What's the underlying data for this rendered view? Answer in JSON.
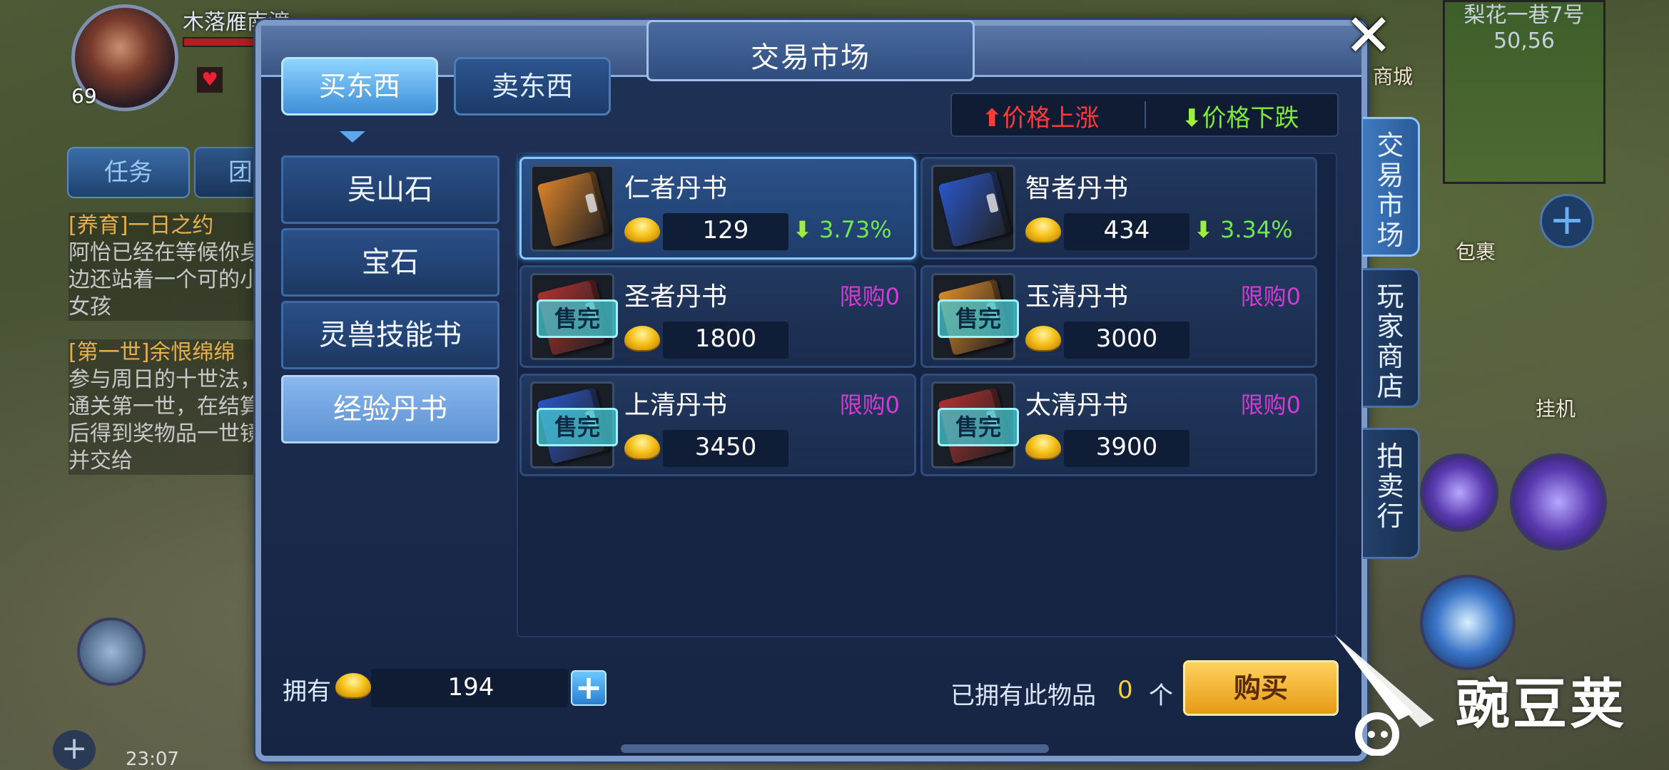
{
  "hud": {
    "player_name": "木落雁南渡",
    "level": "69",
    "task_tab": "任务",
    "team_tab": "团",
    "quests": [
      {
        "title": "[养育]一日之约",
        "desc": "阿怡已经在等候你身边还站着一个可的小女孩"
      },
      {
        "title": "[第一世]余恨绵绵",
        "desc": "参与周日的十世法，通关第一世，在结算后得到奖物品一世镜并交给"
      }
    ],
    "minimap": {
      "location": "梨花一巷7号",
      "coords": "50,56"
    },
    "shop_label": "商城",
    "bag_label": "包裹",
    "auto_label": "挂机",
    "clock": "23:07"
  },
  "dialog": {
    "title": "交易市场",
    "close_icon": "close-x",
    "tabs": [
      {
        "label": "买东西",
        "active": true
      },
      {
        "label": "卖东西",
        "active": false
      }
    ],
    "legend": {
      "up": "价格上涨",
      "down": "价格下跌",
      "up_color": "#ff3a3a",
      "down_color": "#7ee83a"
    },
    "categories": [
      {
        "label": "吴山石",
        "active": false
      },
      {
        "label": "宝石",
        "active": false
      },
      {
        "label": "灵兽技能书",
        "active": false
      },
      {
        "label": "经验丹书",
        "active": true
      }
    ],
    "items": [
      {
        "name": "仁者丹书",
        "price": "129",
        "change": "3.73%",
        "trend": "down",
        "limit": "",
        "sold_out": "",
        "book_color": "#d9822a",
        "selected": true
      },
      {
        "name": "智者丹书",
        "price": "434",
        "change": "3.34%",
        "trend": "down",
        "limit": "",
        "sold_out": "",
        "book_color": "#2a56c8",
        "selected": false
      },
      {
        "name": "圣者丹书",
        "price": "1800",
        "change": "",
        "trend": "",
        "limit": "限购0",
        "sold_out": "售完",
        "book_color": "#b03030",
        "selected": false
      },
      {
        "name": "玉清丹书",
        "price": "3000",
        "change": "",
        "trend": "",
        "limit": "限购0",
        "sold_out": "售完",
        "book_color": "#d98a2a",
        "selected": false
      },
      {
        "name": "上清丹书",
        "price": "3450",
        "change": "",
        "trend": "",
        "limit": "限购0",
        "sold_out": "售完",
        "book_color": "#2a56c8",
        "selected": false
      },
      {
        "name": "太清丹书",
        "price": "3900",
        "change": "",
        "trend": "",
        "limit": "限购0",
        "sold_out": "售完",
        "book_color": "#b03030",
        "selected": false
      }
    ],
    "footer": {
      "owned_label": "拥有",
      "owned_gold": "194",
      "have_label": "已拥有此物品",
      "have_count": "0",
      "have_unit": "个",
      "buy_label": "购买"
    },
    "side_tabs": [
      {
        "label": "交易市场",
        "active": true
      },
      {
        "label": "玩家商店",
        "active": false
      },
      {
        "label": "拍卖行",
        "active": false
      }
    ]
  },
  "watermark": "豌豆荚"
}
